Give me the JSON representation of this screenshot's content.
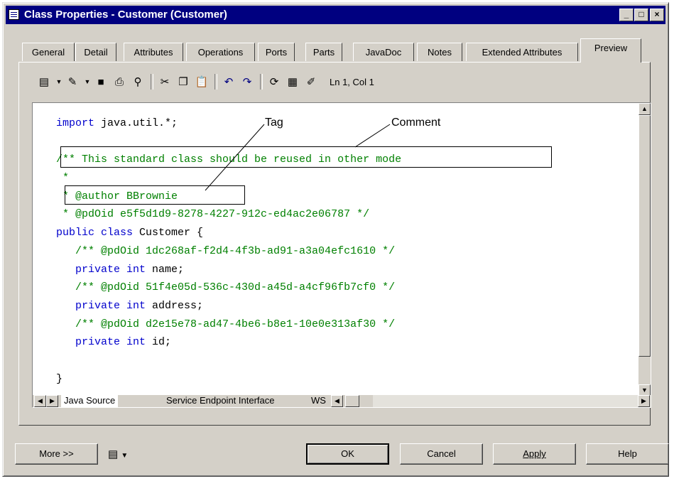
{
  "window": {
    "title": "Class Properties - Customer (Customer)"
  },
  "tabs": [
    "General",
    "Detail",
    "Attributes",
    "Operations",
    "Ports",
    "Parts",
    "JavaDoc",
    "Notes",
    "Extended Attributes",
    "Preview"
  ],
  "active_tab": "Preview",
  "toolbar": {
    "icons": [
      "list-menu-icon",
      "edit-script-icon",
      "save-icon",
      "print-icon",
      "find-icon",
      "cut-icon",
      "copy-icon",
      "paste-icon",
      "undo-icon",
      "redo-icon",
      "refresh-icon",
      "table-icon",
      "edit-icon"
    ],
    "cursor_position": "Ln 1, Col 1"
  },
  "code": {
    "lines": [
      [
        {
          "t": "import",
          "c": "kw"
        },
        {
          "t": " java.util.*;",
          "c": ""
        }
      ],
      [],
      [
        {
          "t": "/** This standard class should be reused in other mode",
          "c": "cm"
        }
      ],
      [
        {
          "t": " *",
          "c": "cm"
        }
      ],
      [
        {
          "t": " * @author BBrownie",
          "c": "cm"
        }
      ],
      [
        {
          "t": " * @pdOid e5f5d1d9-8278-4227-912c-ed4ac2e06787 */",
          "c": "cm"
        }
      ],
      [
        {
          "t": "public class",
          "c": "kw"
        },
        {
          "t": " Customer {",
          "c": ""
        }
      ],
      [
        {
          "t": "   /** @pdOid 1dc268af-f2d4-4f3b-ad91-a3a04efc1610 */",
          "c": "cm"
        }
      ],
      [
        {
          "t": "   private int",
          "c": "kw"
        },
        {
          "t": " name;",
          "c": ""
        }
      ],
      [
        {
          "t": "   /** @pdOid 51f4e05d-536c-430d-a45d-a4cf96fb7cf0 */",
          "c": "cm"
        }
      ],
      [
        {
          "t": "   private int",
          "c": "kw"
        },
        {
          "t": " address;",
          "c": ""
        }
      ],
      [
        {
          "t": "   /** @pdOid d2e15e78-ad47-4be6-b8e1-10e0e313af30 */",
          "c": "cm"
        }
      ],
      [
        {
          "t": "   private int",
          "c": "kw"
        },
        {
          "t": " id;",
          "c": ""
        }
      ],
      [],
      [
        {
          "t": "}",
          "c": ""
        }
      ]
    ]
  },
  "annotations": {
    "tag": "Tag",
    "comment": "Comment"
  },
  "source_tabs": [
    "Java Source",
    "Service Endpoint Interface",
    "WS"
  ],
  "buttons": {
    "more": "More >>",
    "ok": "OK",
    "cancel": "Cancel",
    "apply": "Apply",
    "help": "Help"
  },
  "title_buttons": {
    "minimize": "_",
    "maximize": "□",
    "close": "×"
  }
}
